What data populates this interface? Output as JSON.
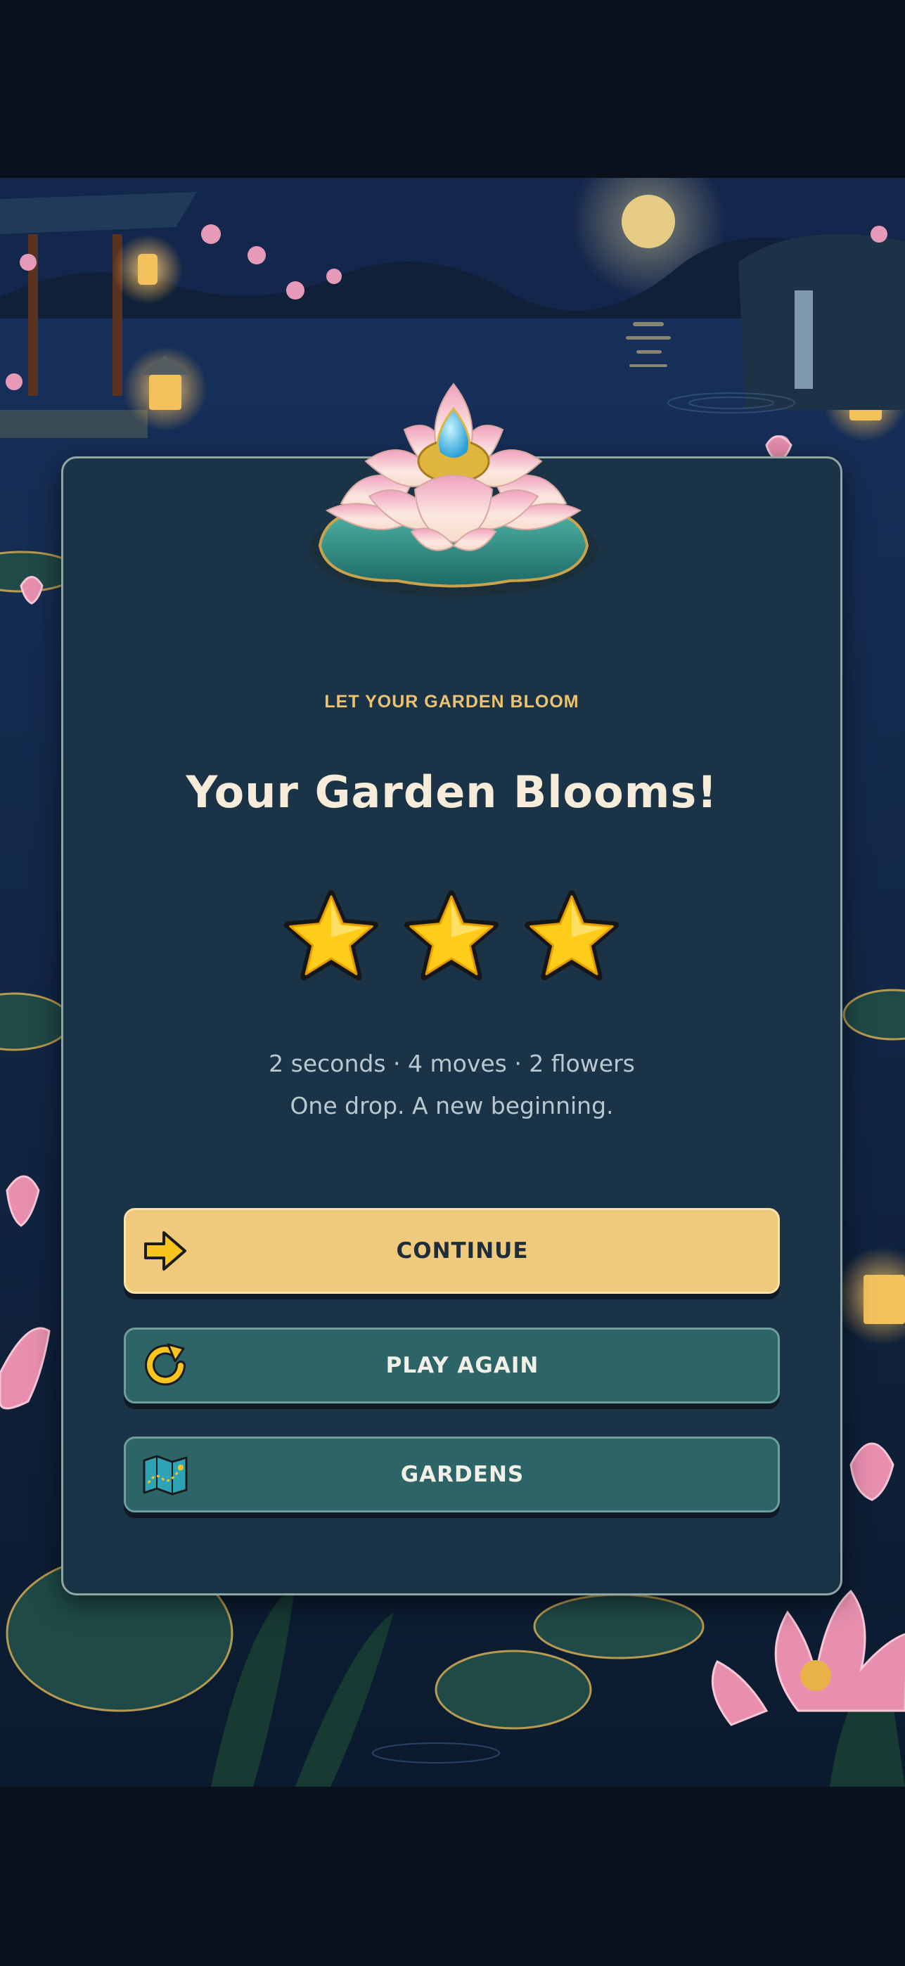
{
  "result": {
    "subtitle": "LET YOUR GARDEN BLOOM",
    "title": "Your Garden Blooms!",
    "stars_earned": 3,
    "stars_total": 3,
    "stats": "2 seconds · 4 moves · 2 flowers",
    "tagline": "One drop. A new beginning."
  },
  "buttons": {
    "continue": {
      "label": "CONTINUE",
      "icon": "arrow-right-icon"
    },
    "play_again": {
      "label": "PLAY AGAIN",
      "icon": "replay-icon"
    },
    "gardens": {
      "label": "GARDENS",
      "icon": "map-icon"
    }
  },
  "colors": {
    "accent_gold": "#efc97c",
    "button_teal": "#2c6468",
    "card_bg": "#1b3346",
    "star_yellow": "#ffcc1a"
  }
}
